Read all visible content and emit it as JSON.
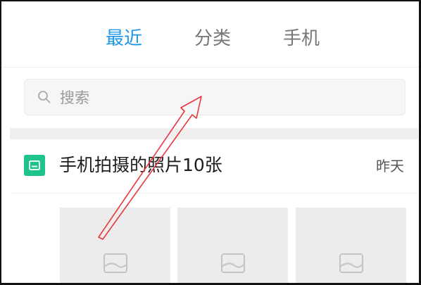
{
  "tabs": [
    {
      "label": "最近",
      "active": true
    },
    {
      "label": "分类",
      "active": false
    },
    {
      "label": "手机",
      "active": false
    }
  ],
  "search": {
    "placeholder": "搜索",
    "value": ""
  },
  "group": {
    "title": "手机拍摄的照片10张",
    "date": "昨天",
    "icon": "gallery-icon"
  },
  "thumbnails": [
    {
      "icon": "image-placeholder-icon"
    },
    {
      "icon": "image-placeholder-icon"
    },
    {
      "icon": "image-placeholder-icon"
    }
  ],
  "colors": {
    "accent": "#1f95e8",
    "group_icon": "#1ec38e",
    "annotation": "#e8383d"
  }
}
